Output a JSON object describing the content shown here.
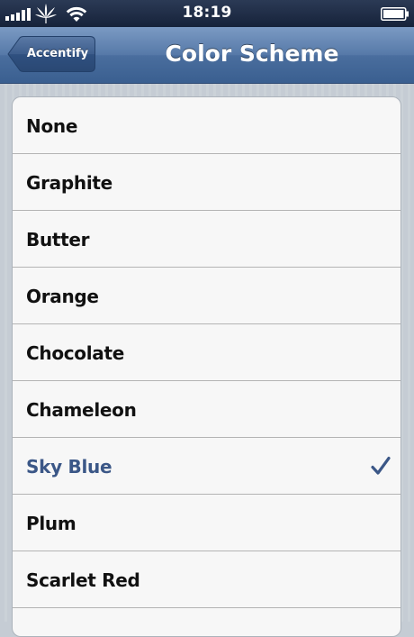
{
  "status_bar": {
    "time": "18:19",
    "signal_icon": "signal-bars-icon",
    "carrier_icon": "leaf-icon",
    "wifi_icon": "wifi-icon",
    "battery_icon": "battery-icon"
  },
  "nav": {
    "back_label": "Accentify",
    "title": "Color Scheme"
  },
  "list": {
    "items": [
      {
        "label": "None",
        "selected": false
      },
      {
        "label": "Graphite",
        "selected": false
      },
      {
        "label": "Butter",
        "selected": false
      },
      {
        "label": "Orange",
        "selected": false
      },
      {
        "label": "Chocolate",
        "selected": false
      },
      {
        "label": "Chameleon",
        "selected": false
      },
      {
        "label": "Sky Blue",
        "selected": true
      },
      {
        "label": "Plum",
        "selected": false
      },
      {
        "label": "Scarlet Red",
        "selected": false
      }
    ],
    "check_icon": "checkmark-icon"
  },
  "colors": {
    "nav_bar": "#4a6e9e",
    "selected_text": "#3b5787",
    "checkmark": "#3b5787",
    "list_background": "#f7f7f7",
    "page_background": "#c5ccd4"
  }
}
